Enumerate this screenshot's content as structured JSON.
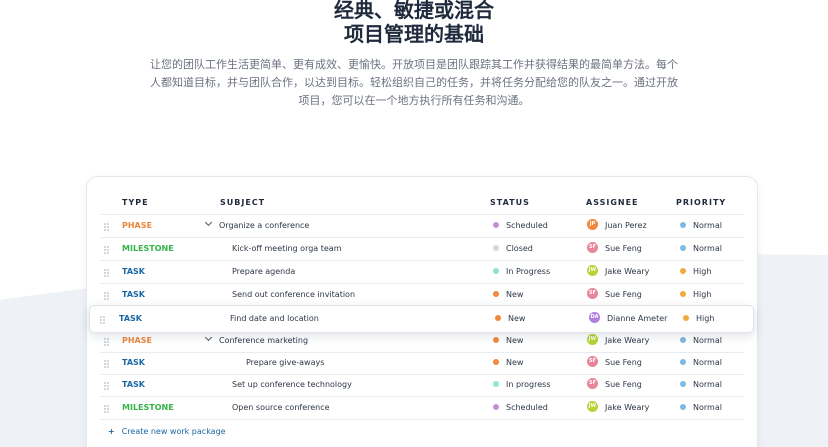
{
  "hero": {
    "title_line1": "经典、敏捷或混合",
    "title_line2": "项目管理的基础",
    "description": "让您的团队工作生活更简单、更有成效、更愉快。开放项目是团队跟踪其工作并获得结果的最简单方法。每个人都知道目标，并与团队合作，以达到目标。轻松组织自己的任务，并将任务分配给您的队友之一。通过开放项目，您可以在一个地方执行所有任务和沟通。"
  },
  "table": {
    "headers": {
      "type": "TYPE",
      "subject": "SUBJECT",
      "status": "STATUS",
      "assignee": "ASSIGNEE",
      "priority": "PRIORITY"
    },
    "rows": [
      {
        "type": "PHASE",
        "type_color": "#e8873a",
        "subject": "Organize a conference",
        "status": "Scheduled",
        "status_color": "#c58fd6",
        "assignee": "Juan Perez",
        "initials": "JP",
        "avatar_color": "#f0883e",
        "priority": "Normal",
        "priority_color": "#7fb8e0"
      },
      {
        "type": "MILESTONE",
        "type_color": "#35b34a",
        "subject": "Kick-off meeting orga team",
        "status": "Closed",
        "status_color": "#d6d6d6",
        "assignee": "Sue Feng",
        "initials": "SF",
        "avatar_color": "#e8859a",
        "priority": "Normal",
        "priority_color": "#7fb8e0"
      },
      {
        "type": "TASK",
        "type_color": "#1a67a3",
        "subject": "Prepare agenda",
        "status": "In Progress",
        "status_color": "#8fe3d5",
        "assignee": "Jake Weary",
        "initials": "JW",
        "avatar_color": "#b5d335",
        "priority": "High",
        "priority_color": "#f2a93b"
      },
      {
        "type": "TASK",
        "type_color": "#1a67a3",
        "subject": "Send out conference invitation",
        "status": "New",
        "status_color": "#f0883e",
        "assignee": "Sue Feng",
        "initials": "SF",
        "avatar_color": "#e8859a",
        "priority": "High",
        "priority_color": "#f2a93b"
      },
      {
        "type": "PHASE",
        "type_color": "#e8873a",
        "subject": "Conference marketing",
        "status": "New",
        "status_color": "#f0883e",
        "assignee": "Jake Weary",
        "initials": "JW",
        "avatar_color": "#b5d335",
        "priority": "Normal",
        "priority_color": "#7fb8e0"
      },
      {
        "type": "TASK",
        "type_color": "#1a67a3",
        "subject": "Prepare give-aways",
        "status": "New",
        "status_color": "#f0883e",
        "assignee": "Sue Feng",
        "initials": "SF",
        "avatar_color": "#e8859a",
        "priority": "Normal",
        "priority_color": "#7fb8e0"
      },
      {
        "type": "TASK",
        "type_color": "#1a67a3",
        "subject": "Set up conference technology",
        "status": "In progress",
        "status_color": "#8fe3d5",
        "assignee": "Sue Feng",
        "initials": "SF",
        "avatar_color": "#e8859a",
        "priority": "Normal",
        "priority_color": "#7fb8e0"
      },
      {
        "type": "MILESTONE",
        "type_color": "#35b34a",
        "subject": "Open source conference",
        "status": "Scheduled",
        "status_color": "#c58fd6",
        "assignee": "Jake Weary",
        "initials": "JW",
        "avatar_color": "#b5d335",
        "priority": "Normal",
        "priority_color": "#7fb8e0"
      }
    ],
    "dragged_row": {
      "type": "TASK",
      "type_color": "#1a67a3",
      "subject": "Find date and location",
      "status": "New",
      "status_color": "#f0883e",
      "assignee": "Dianne Ameter",
      "initials": "DA",
      "avatar_color": "#b07de0",
      "priority": "High",
      "priority_color": "#f2a93b"
    },
    "create_label": "Create new work package"
  }
}
